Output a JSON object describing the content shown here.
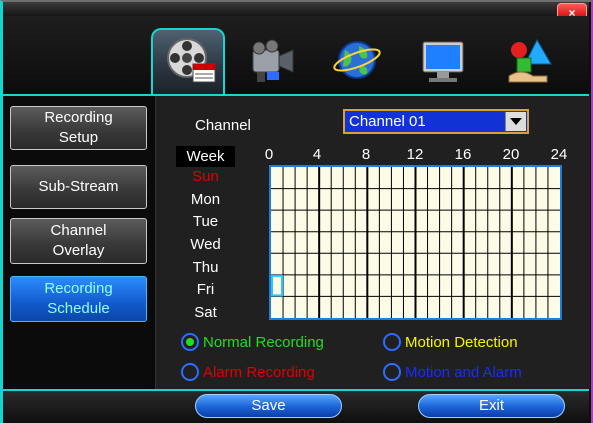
{
  "window": {
    "close_label": "×"
  },
  "toolbar": {
    "icons": [
      {
        "name": "recording-reel-icon",
        "active": true
      },
      {
        "name": "video-camera-icon",
        "active": false
      },
      {
        "name": "network-globe-icon",
        "active": false
      },
      {
        "name": "monitor-display-icon",
        "active": false
      },
      {
        "name": "system-tools-icon",
        "active": false
      }
    ],
    "accent_color": "#12d7d3"
  },
  "sidebar": {
    "items": [
      {
        "line1": "Recording",
        "line2": "Setup",
        "active": false
      },
      {
        "line1": "Sub-Stream",
        "line2": "",
        "active": false
      },
      {
        "line1": "Channel",
        "line2": "Overlay",
        "active": false
      },
      {
        "line1": "Recording",
        "line2": "Schedule",
        "active": true
      }
    ]
  },
  "schedule": {
    "channel_label": "Channel",
    "channel_value": "Channel 01",
    "week_header": "Week",
    "hours": [
      "0",
      "4",
      "8",
      "12",
      "16",
      "20",
      "24"
    ],
    "days": [
      {
        "label": "Sun",
        "color": "#e00000"
      },
      {
        "label": "Mon",
        "color": "#ffffff"
      },
      {
        "label": "Tue",
        "color": "#ffffff"
      },
      {
        "label": "Wed",
        "color": "#ffffff"
      },
      {
        "label": "Thu",
        "color": "#ffffff"
      },
      {
        "label": "Fri",
        "color": "#ffffff"
      },
      {
        "label": "Sat",
        "color": "#ffffff"
      }
    ],
    "grid_color": "#fdfbe6",
    "selected_cell": {
      "day": "Fri",
      "hour": 0
    }
  },
  "legend": {
    "normal": {
      "label": "Normal Recording",
      "color": "#22dd22",
      "selected": true
    },
    "motion": {
      "label": "Motion Detection",
      "color": "#f5f500",
      "selected": false
    },
    "alarm": {
      "label": "Alarm Recording",
      "color": "#e00000",
      "selected": false
    },
    "motion_alarm": {
      "label": "Motion and Alarm",
      "color": "#1a2cff",
      "selected": false
    }
  },
  "actions": {
    "save_label": "Save",
    "exit_label": "Exit"
  }
}
